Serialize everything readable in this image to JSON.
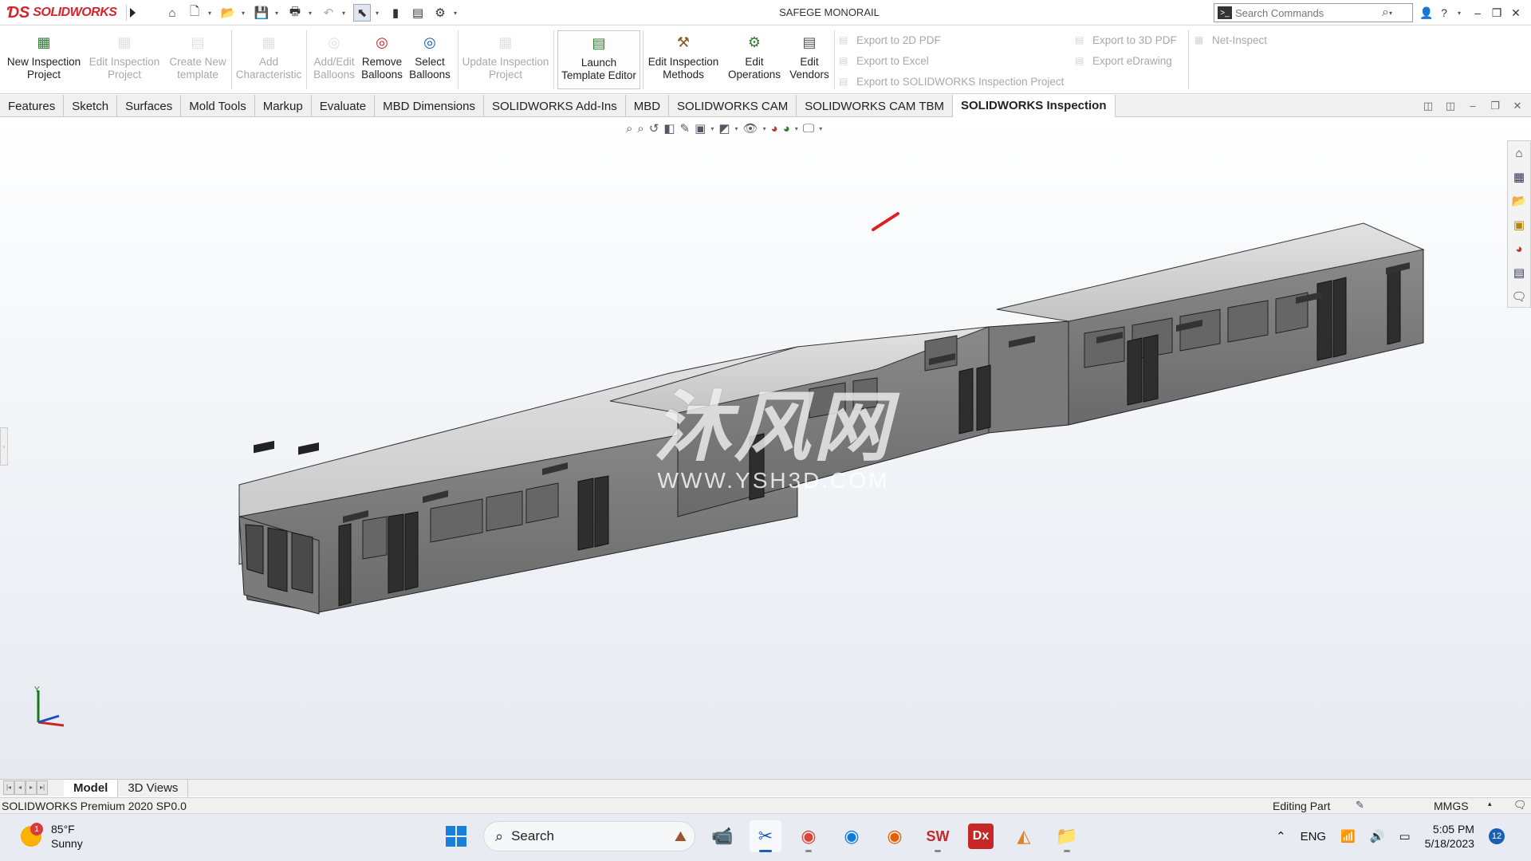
{
  "window": {
    "logo_text": "SOLIDWORKS",
    "title": "SAFEGE MONORAIL",
    "search_placeholder": "Search Commands"
  },
  "ribbon": {
    "buttons": [
      {
        "label": "New Inspection Project",
        "icon": "new-inspection-icon",
        "enabled": true
      },
      {
        "label": "Edit Inspection Project",
        "icon": "edit-inspection-icon",
        "enabled": false
      },
      {
        "label": "Create New template",
        "icon": "template-icon",
        "enabled": false
      },
      {
        "label": "Add Characteristic",
        "icon": "add-characteristic-icon",
        "enabled": false
      },
      {
        "label": "Add/Edit Balloons",
        "icon": "balloon-icon",
        "enabled": false
      },
      {
        "label": "Remove Balloons",
        "icon": "remove-balloon-icon",
        "enabled": true
      },
      {
        "label": "Select Balloons",
        "icon": "select-balloon-icon",
        "enabled": true
      },
      {
        "label": "Update Inspection Project",
        "icon": "update-icon",
        "enabled": false
      },
      {
        "label": "Launch Template Editor",
        "icon": "template-editor-icon",
        "enabled": true
      },
      {
        "label": "Edit Inspection Methods",
        "icon": "methods-icon",
        "enabled": true
      },
      {
        "label": "Edit Operations",
        "icon": "operations-icon",
        "enabled": true
      },
      {
        "label": "Edit Vendors",
        "icon": "vendors-icon",
        "enabled": true
      }
    ],
    "exports_left": [
      "Export to 2D PDF",
      "Export to Excel",
      "Export to SOLIDWORKS Inspection Project"
    ],
    "exports_right": [
      "Export to 3D PDF",
      "Export eDrawing"
    ],
    "net_inspect": "Net-Inspect"
  },
  "tabs": [
    "Features",
    "Sketch",
    "Surfaces",
    "Mold Tools",
    "Markup",
    "Evaluate",
    "MBD Dimensions",
    "SOLIDWORKS Add-Ins",
    "MBD",
    "SOLIDWORKS CAM",
    "SOLIDWORKS CAM TBM",
    "SOLIDWORKS Inspection"
  ],
  "active_tab": "SOLIDWORKS Inspection",
  "watermark": {
    "cn": "沐风网",
    "url": "WWW.YSH3D.COM"
  },
  "triad": {
    "y_label": "Y"
  },
  "model_tabs": [
    "Model",
    "3D Views"
  ],
  "status": {
    "product": "SOLIDWORKS Premium 2020 SP0.0",
    "mode": "Editing Part",
    "units": "MMGS"
  },
  "taskbar": {
    "temperature": "85°F",
    "condition": "Sunny",
    "weather_badge": "1",
    "search_label": "Search",
    "language": "ENG",
    "time": "5:05 PM",
    "date": "5/18/2023",
    "notifications": "12"
  },
  "colors": {
    "accent": "#d8232a",
    "taskbar_accent": "#1a5fb4"
  }
}
